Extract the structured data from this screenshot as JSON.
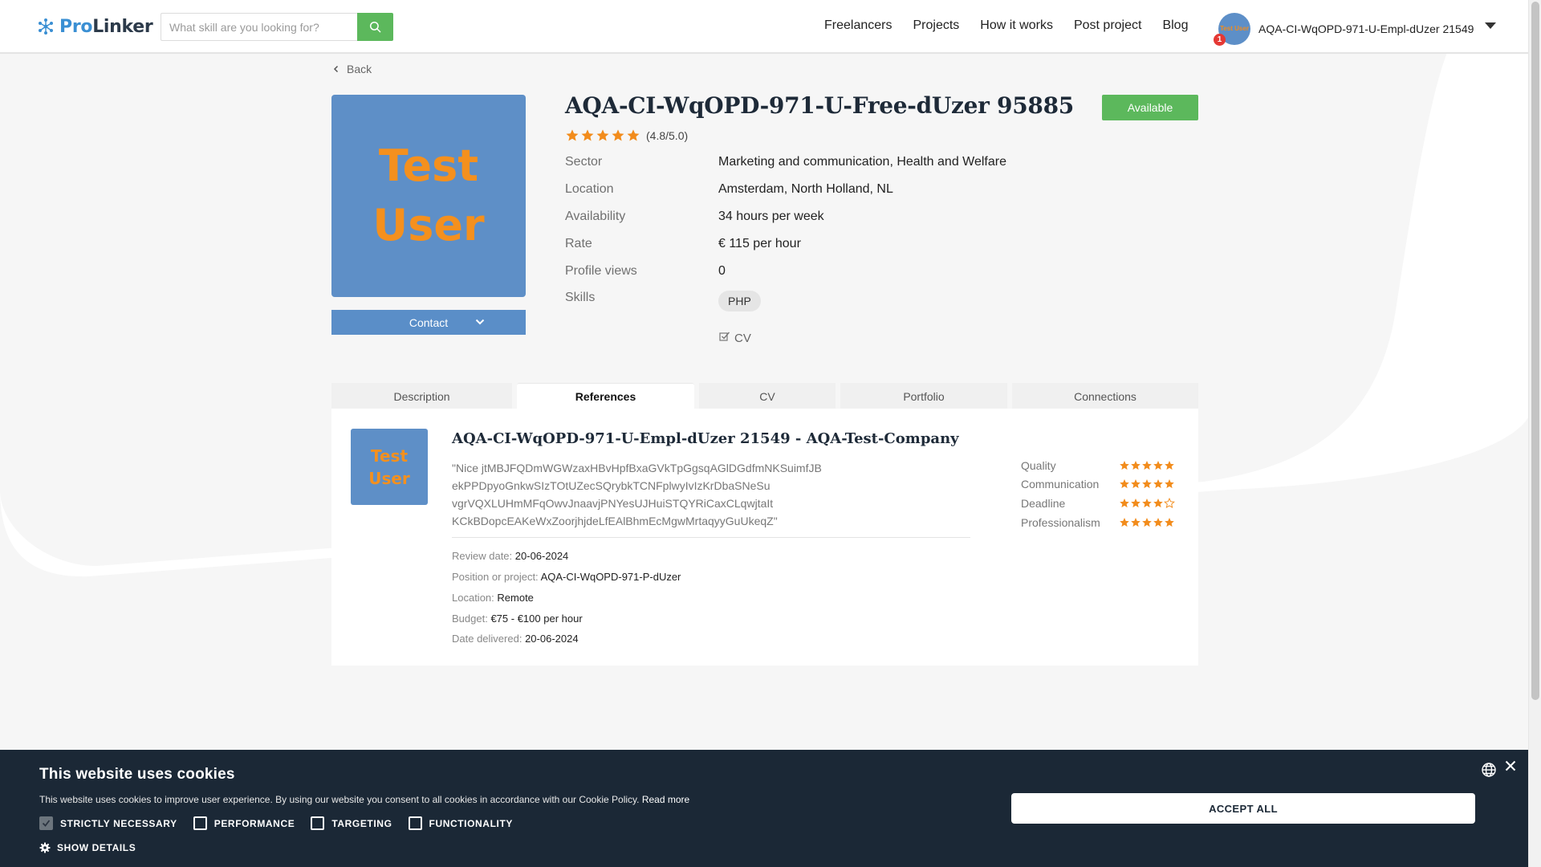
{
  "header": {
    "logo_pro": "Pro",
    "logo_linker": "Linker",
    "search_placeholder": "What skill are you looking for?",
    "nav": [
      "Freelancers",
      "Projects",
      "How it works",
      "Post project",
      "Blog"
    ],
    "user_name": "AQA-CI-WqOPD-971-U-Empl-dUzer 21549",
    "notification_count": "1",
    "avatar_text": "Test User"
  },
  "back_label": "Back",
  "profile": {
    "photo_line1": "Test",
    "photo_line2": "User",
    "contact_label": "Contact",
    "name": "AQA-CI-WqOPD-971-U-Free-dUzer 95885",
    "status": "Available",
    "rating": 4.8,
    "rating_text": "(4.8/5.0)",
    "details": [
      {
        "label": "Sector",
        "value": "Marketing and communication, Health and Welfare"
      },
      {
        "label": "Location",
        "value": "Amsterdam, North Holland, NL"
      },
      {
        "label": "Availability",
        "value": "34 hours per week"
      },
      {
        "label": "Rate",
        "value": "€ 115 per hour"
      },
      {
        "label": "Profile views",
        "value": "0"
      }
    ],
    "skills_label": "Skills",
    "skills": [
      "PHP"
    ],
    "cv_label": "CV"
  },
  "tabs": [
    "Description",
    "References",
    "CV",
    "Portfolio",
    "Connections"
  ],
  "active_tab": "References",
  "reference": {
    "avatar_line1": "Test",
    "avatar_line2": "User",
    "title": "AQA-CI-WqOPD-971-U-Empl-dUzer 21549 - AQA-Test-Company",
    "quote_lines": [
      "\"Nice jtMBJFQDmWGWzaxHBvHpfBxaGVkTpGgsqAGlDGdfmNKSuimfJB",
      "ekPPDpyoGnkwSIzTOtUZecSQrybkTCNFplwyIvIzKrDbaSNeSu",
      "vgrVQXLUHmMFqOwvJnaavjPNYesUJHuiSTQYRiCaxCLqwjtaIt",
      "KCkBDopcEAKeWxZoorjhjdeLfEAlBhmEcMgwMrtaqyyGuUkeqZ\""
    ],
    "meta": [
      {
        "label": "Review date:",
        "value": "20-06-2024"
      },
      {
        "label": "Position or project:",
        "value": "AQA-CI-WqOPD-971-P-dUzer"
      },
      {
        "label": "Location:",
        "value": "Remote"
      },
      {
        "label": "Budget:",
        "value": "€75 - €100 per hour"
      },
      {
        "label": "Date delivered:",
        "value": "20-06-2024"
      }
    ],
    "scores": [
      {
        "label": "Quality",
        "stars": 5
      },
      {
        "label": "Communication",
        "stars": 5
      },
      {
        "label": "Deadline",
        "stars": 4
      },
      {
        "label": "Professionalism",
        "stars": 5
      }
    ]
  },
  "cookie": {
    "title": "This website uses cookies",
    "text": "This website uses cookies to improve user experience. By using our website you consent to all cookies in accordance with our Cookie Policy.",
    "read_more": "Read more",
    "options": [
      {
        "label": "STRICTLY NECESSARY",
        "checked": true
      },
      {
        "label": "PERFORMANCE",
        "checked": false
      },
      {
        "label": "TARGETING",
        "checked": false
      },
      {
        "label": "FUNCTIONALITY",
        "checked": false
      }
    ],
    "show_details": "SHOW DETAILS",
    "accept_label": "ACCEPT ALL"
  },
  "colors": {
    "brand_blue": "#3a8fd3",
    "accent_green": "#5cb85c",
    "star_orange": "#f28c1c",
    "cookie_bg": "#1b2836",
    "avatar_blue": "#5e8fc7"
  }
}
